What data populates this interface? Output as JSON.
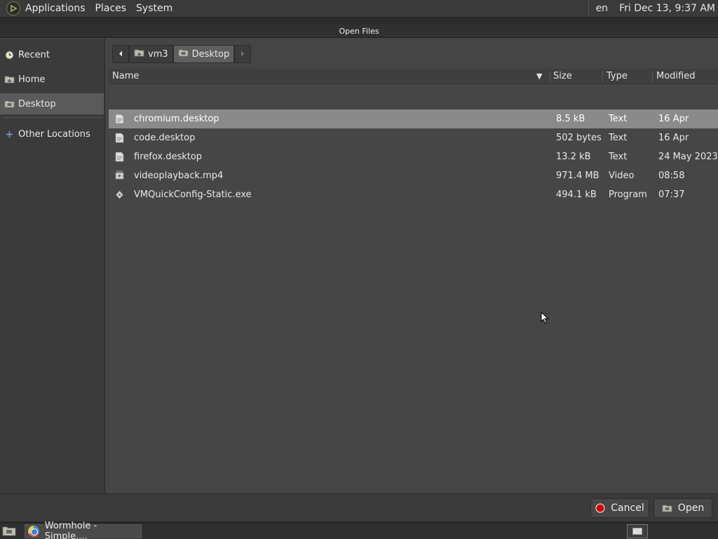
{
  "top_panel": {
    "menu": [
      "Applications",
      "Places",
      "System"
    ],
    "language": "en",
    "clock": "Fri Dec 13,  9:37 AM"
  },
  "dialog": {
    "title": "Open Files"
  },
  "sidebar": {
    "items": [
      {
        "label": "Recent",
        "icon": "clock-icon"
      },
      {
        "label": "Home",
        "icon": "home-folder-icon"
      },
      {
        "label": "Desktop",
        "icon": "desktop-folder-icon"
      },
      {
        "label": "Other Locations",
        "icon": "plus-icon"
      }
    ],
    "active": "Desktop"
  },
  "pathbar": {
    "segments": [
      "vm3",
      "Desktop"
    ],
    "active": "Desktop"
  },
  "file_list": {
    "columns": {
      "name": "Name",
      "size": "Size",
      "type": "Type",
      "modified": "Modified"
    },
    "sort_indicator": "▼",
    "rows": [
      {
        "name": "chromium.desktop",
        "size": "8.5 kB",
        "type": "Text",
        "modified": "16 Apr",
        "icon": "text-file-icon"
      },
      {
        "name": "code.desktop",
        "size": "502 bytes",
        "type": "Text",
        "modified": "16 Apr",
        "icon": "text-file-icon"
      },
      {
        "name": "firefox.desktop",
        "size": "13.2 kB",
        "type": "Text",
        "modified": "24 May 2023",
        "icon": "text-file-icon"
      },
      {
        "name": "videoplayback.mp4",
        "size": "971.4 MB",
        "type": "Video",
        "modified": "08:58",
        "icon": "video-file-icon"
      },
      {
        "name": "VMQuickConfig-Static.exe",
        "size": "494.1 kB",
        "type": "Program",
        "modified": "07:37",
        "icon": "program-file-icon"
      }
    ],
    "selected_index": 0
  },
  "actions": {
    "cancel_label": "Cancel",
    "open_label": "Open"
  },
  "taskbar": {
    "task_label": "Wormhole - Simple,..."
  },
  "colors": {
    "panel_bg": "#3a3a3a",
    "dialog_bg": "#454545",
    "selection": "#8a8a8a",
    "cancel_red": "#cc0000"
  }
}
